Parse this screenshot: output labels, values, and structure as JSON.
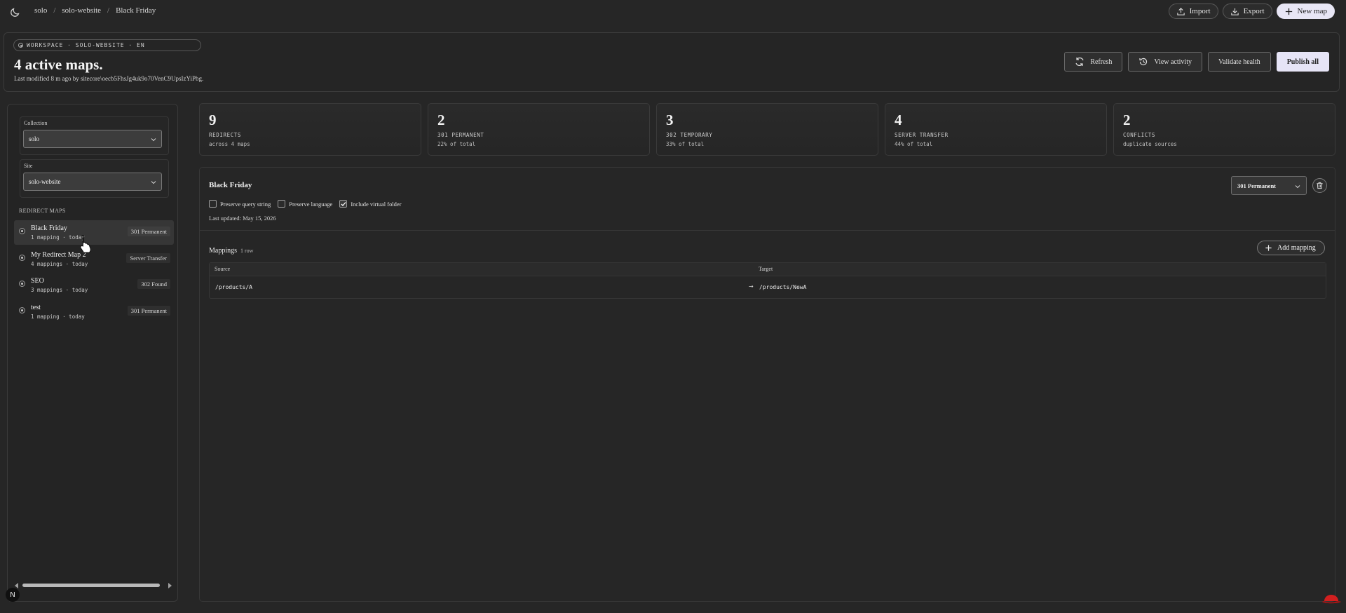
{
  "breadcrumb": {
    "items": [
      "solo",
      "solo-website",
      "Black Friday"
    ],
    "separator": "/"
  },
  "top_actions": {
    "import": "Import",
    "export": "Export",
    "new_map": "New map"
  },
  "header": {
    "workspace_chip": "WORKSPACE · SOLO-WEBSITE · EN",
    "title": "4 active maps.",
    "subtitle": "Last modified 8 m ago by sitecore\\oecb5FhsJg4uk9o70VenC9UpsIzYiPbg.",
    "actions": {
      "refresh": "Refresh",
      "view_activity": "View activity",
      "validate_health": "Validate health",
      "publish_all": "Publish all"
    }
  },
  "sidebar": {
    "collection": {
      "label": "Collection",
      "value": "solo"
    },
    "site": {
      "label": "Site",
      "value": "solo-website"
    },
    "section_title": "REDIRECT MAPS",
    "maps": [
      {
        "name": "Black Friday",
        "meta": "1 mapping · today",
        "badge": "301 Permanent",
        "active": true
      },
      {
        "name": "My Redirect Map 2",
        "meta": "4 mappings · today",
        "badge": "Server Transfer",
        "active": false
      },
      {
        "name": "SEO",
        "meta": "3 mappings · today",
        "badge": "302 Found",
        "active": false
      },
      {
        "name": "test",
        "meta": "1 mapping · today",
        "badge": "301 Permanent",
        "active": false
      }
    ]
  },
  "stats": [
    {
      "value": "9",
      "label": "REDIRECTS",
      "sub": "across 4 maps"
    },
    {
      "value": "2",
      "label": "301 PERMANENT",
      "sub": "22% of total"
    },
    {
      "value": "3",
      "label": "302 TEMPORARY",
      "sub": "33% of total"
    },
    {
      "value": "4",
      "label": "SERVER TRANSFER",
      "sub": "44% of total"
    },
    {
      "value": "2",
      "label": "CONFLICTS",
      "sub": "duplicate sources"
    }
  ],
  "detail": {
    "title": "Black Friday",
    "redirect_type": "301 Permanent",
    "options": [
      {
        "label": "Preserve query string",
        "checked": false
      },
      {
        "label": "Preserve language",
        "checked": false
      },
      {
        "label": "Include virtual folder",
        "checked": true
      }
    ],
    "last_updated": "Last updated: May 15, 2026",
    "mappings_title": "Mappings",
    "mappings_count": "1 row",
    "add_mapping": "Add mapping",
    "columns": {
      "source": "Source",
      "target": "Target"
    },
    "rows": [
      {
        "source": "/products/A",
        "arrow": "→",
        "target": "/products/NewA"
      }
    ]
  },
  "corner_badge": "N"
}
